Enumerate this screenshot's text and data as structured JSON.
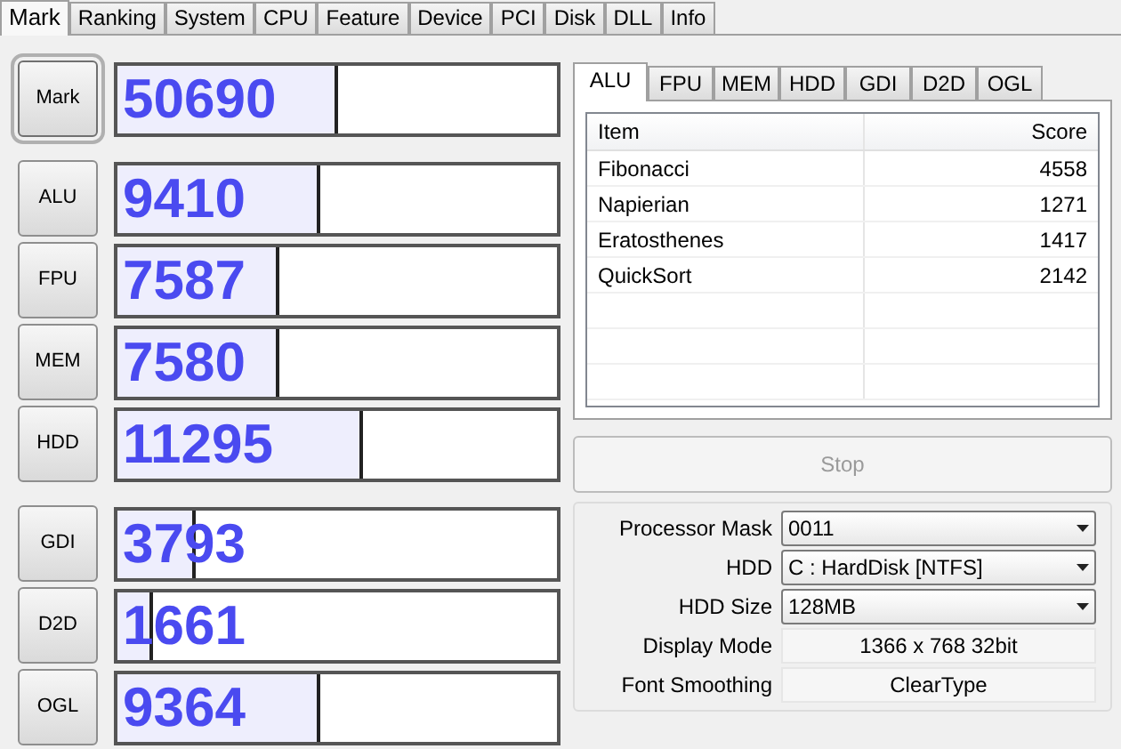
{
  "tabs": [
    {
      "label": "Mark",
      "selected": true
    },
    {
      "label": "Ranking",
      "selected": false
    },
    {
      "label": "System",
      "selected": false
    },
    {
      "label": "CPU",
      "selected": false
    },
    {
      "label": "Feature",
      "selected": false
    },
    {
      "label": "Device",
      "selected": false
    },
    {
      "label": "PCI",
      "selected": false
    },
    {
      "label": "Disk",
      "selected": false
    },
    {
      "label": "DLL",
      "selected": false
    },
    {
      "label": "Info",
      "selected": false
    }
  ],
  "scores": [
    {
      "label": "Mark",
      "value": "50690",
      "level": 0.5,
      "selected": true
    },
    {
      "label": "ALU",
      "value": "9410",
      "level": 0.46,
      "selected": false
    },
    {
      "label": "FPU",
      "value": "7587",
      "level": 0.37,
      "selected": false
    },
    {
      "label": "MEM",
      "value": "7580",
      "level": 0.37,
      "selected": false
    },
    {
      "label": "HDD",
      "value": "11295",
      "level": 0.56,
      "selected": false
    },
    {
      "label": "GDI",
      "value": "3793",
      "level": 0.18,
      "selected": false
    },
    {
      "label": "D2D",
      "value": "1661",
      "level": 0.08,
      "selected": false
    },
    {
      "label": "OGL",
      "value": "9364",
      "level": 0.46,
      "selected": false
    }
  ],
  "sub_tabs": [
    {
      "label": "ALU",
      "selected": true
    },
    {
      "label": "FPU",
      "selected": false
    },
    {
      "label": "MEM",
      "selected": false
    },
    {
      "label": "HDD",
      "selected": false
    },
    {
      "label": "GDI",
      "selected": false
    },
    {
      "label": "D2D",
      "selected": false
    },
    {
      "label": "OGL",
      "selected": false
    }
  ],
  "table": {
    "columns": [
      "Item",
      "Score"
    ],
    "rows": [
      [
        "Fibonacci",
        "4558"
      ],
      [
        "Napierian",
        "1271"
      ],
      [
        "Eratosthenes",
        "1417"
      ],
      [
        "QuickSort",
        "2142"
      ]
    ]
  },
  "stop_button": {
    "label": "Stop",
    "disabled": true
  },
  "settings": [
    {
      "kind": "dropdown",
      "label": "Processor Mask",
      "value": "0011"
    },
    {
      "kind": "dropdown",
      "label": "HDD",
      "value": "C : HardDisk [NTFS]"
    },
    {
      "kind": "dropdown",
      "label": "HDD Size",
      "value": "128MB"
    },
    {
      "kind": "readout",
      "label": "Display Mode",
      "value": "1366 x 768 32bit"
    },
    {
      "kind": "readout",
      "label": "Font Smoothing",
      "value": "ClearType"
    }
  ]
}
